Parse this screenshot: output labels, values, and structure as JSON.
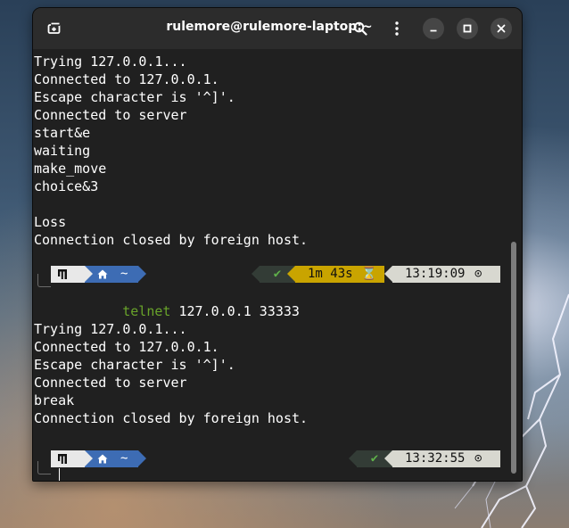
{
  "window": {
    "title": "rulemore@rulemore-laptop:~"
  },
  "icons": {
    "new_tab": "new-tab-icon",
    "search": "search-icon",
    "menu": "kebab-menu-icon",
    "minimize": "minimize-icon",
    "maximize": "maximize-icon",
    "close": "close-icon"
  },
  "colors": {
    "terminal_bg": "#202020",
    "home_segment": "#3d6cb4",
    "duration_segment": "#c9a400",
    "time_segment": "#d8d8d0",
    "status_ok": "#5fb04a",
    "command_green": "#69a32a"
  },
  "output_block_1": [
    "Trying 127.0.0.1...",
    "Connected to 127.0.0.1.",
    "Escape character is '^]'.",
    "Connected to server",
    "start&e",
    "waiting",
    "make_move",
    "choice&3",
    "",
    "Loss",
    "Connection closed by foreign host."
  ],
  "prompt_1": {
    "home_dir": "~",
    "status_check": "✔",
    "duration": "1m 43s",
    "duration_icon": "⌛",
    "time": "13:19:09",
    "time_icon": "⊙",
    "command": "telnet",
    "args": "127.0.0.1 33333"
  },
  "output_block_2": [
    "Trying 127.0.0.1...",
    "Connected to 127.0.0.1.",
    "Escape character is '^]'.",
    "Connected to server",
    "break",
    "Connection closed by foreign host."
  ],
  "prompt_2": {
    "home_dir": "~",
    "status_check": "✔",
    "time": "13:32:55",
    "time_icon": "⊙"
  }
}
